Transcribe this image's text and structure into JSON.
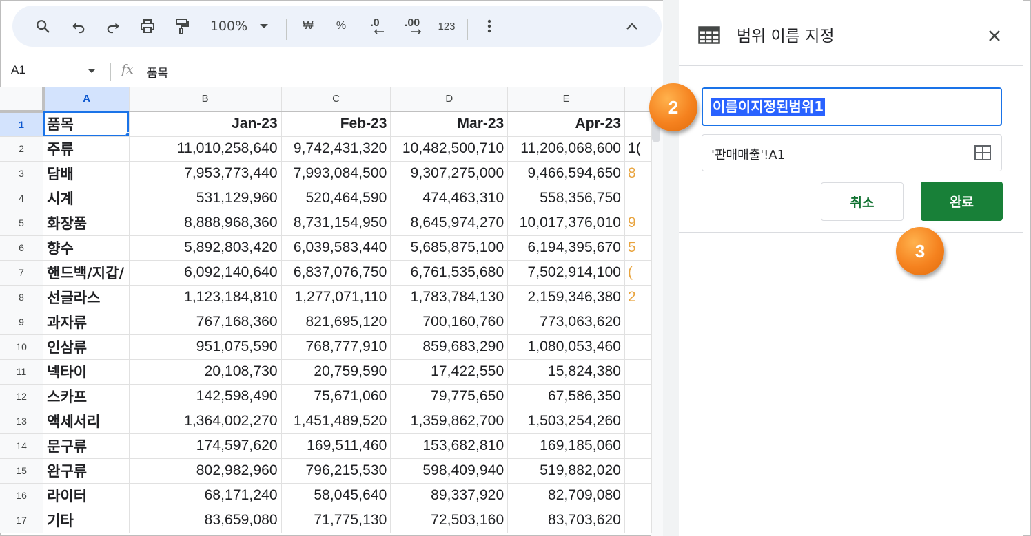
{
  "toolbar": {
    "zoom": "100%",
    "currency": "₩",
    "percent": "%",
    "decimal_decrease": ".0",
    "decimal_increase": ".00",
    "format_number": "123"
  },
  "formula_bar": {
    "name_box": "A1",
    "fx": "fx",
    "content": "품목"
  },
  "grid": {
    "columns": [
      "A",
      "B",
      "C",
      "D",
      "E"
    ],
    "header_row": {
      "row": "1",
      "item": "품목",
      "values": [
        "Jan-23",
        "Feb-23",
        "Mar-23",
        "Apr-23"
      ]
    },
    "rows": [
      {
        "row": "2",
        "item": "주류",
        "values": [
          "11,010,258,640",
          "9,742,431,320",
          "10,482,500,710",
          "11,206,068,600"
        ],
        "partial": "1("
      },
      {
        "row": "3",
        "item": "담배",
        "values": [
          "7,953,773,440",
          "7,993,084,500",
          "9,307,275,000",
          "9,466,594,650"
        ],
        "partial": "8"
      },
      {
        "row": "4",
        "item": "시계",
        "values": [
          "531,129,960",
          "520,464,590",
          "474,463,310",
          "558,356,750"
        ],
        "partial": ""
      },
      {
        "row": "5",
        "item": "화장품",
        "values": [
          "8,888,968,360",
          "8,731,154,950",
          "8,645,974,270",
          "10,017,376,010"
        ],
        "partial": "9"
      },
      {
        "row": "6",
        "item": "향수",
        "values": [
          "5,892,803,420",
          "6,039,583,440",
          "5,685,875,100",
          "6,194,395,670"
        ],
        "partial": "5"
      },
      {
        "row": "7",
        "item": "핸드백/지갑/",
        "values": [
          "6,092,140,640",
          "6,837,076,750",
          "6,761,535,680",
          "7,502,914,100"
        ],
        "partial": "("
      },
      {
        "row": "8",
        "item": "선글라스",
        "values": [
          "1,123,184,810",
          "1,277,071,110",
          "1,783,784,130",
          "2,159,346,380"
        ],
        "partial": "2"
      },
      {
        "row": "9",
        "item": "과자류",
        "values": [
          "767,168,360",
          "821,695,120",
          "700,160,760",
          "773,063,620"
        ],
        "partial": ""
      },
      {
        "row": "10",
        "item": "인삼류",
        "values": [
          "951,075,590",
          "768,777,910",
          "859,683,290",
          "1,080,053,460"
        ],
        "partial": ""
      },
      {
        "row": "11",
        "item": "넥타이",
        "values": [
          "20,108,730",
          "20,759,590",
          "17,422,550",
          "15,824,380"
        ],
        "partial": ""
      },
      {
        "row": "12",
        "item": "스카프",
        "values": [
          "142,598,490",
          "75,671,060",
          "79,775,650",
          "67,586,350"
        ],
        "partial": ""
      },
      {
        "row": "13",
        "item": "액세서리",
        "values": [
          "1,364,002,270",
          "1,451,489,520",
          "1,359,862,700",
          "1,503,254,260"
        ],
        "partial": ""
      },
      {
        "row": "14",
        "item": "문구류",
        "values": [
          "174,597,620",
          "169,511,460",
          "153,682,810",
          "169,185,060"
        ],
        "partial": ""
      },
      {
        "row": "15",
        "item": "완구류",
        "values": [
          "802,982,960",
          "796,215,530",
          "598,409,940",
          "519,882,020"
        ],
        "partial": ""
      },
      {
        "row": "16",
        "item": "라이터",
        "values": [
          "68,171,240",
          "58,045,640",
          "89,337,920",
          "82,709,080"
        ],
        "partial": ""
      },
      {
        "row": "17",
        "item": "기타",
        "values": [
          "83,659,080",
          "71,775,130",
          "72,503,160",
          "83,703,620"
        ],
        "partial": ""
      }
    ]
  },
  "panel": {
    "title": "범위 이름 지정",
    "name_value": "이름이지정된범위1",
    "range_value": "'판매매출'!A1",
    "cancel_label": "취소",
    "done_label": "완료"
  },
  "badges": {
    "step2": "2",
    "step3": "3"
  },
  "colors": {
    "accent_blue": "#1a73e8",
    "done_green": "#188038",
    "cancel_text_green": "#137333",
    "badge_orange": "#f5821f",
    "toolbar_bg": "#edf2fa"
  }
}
